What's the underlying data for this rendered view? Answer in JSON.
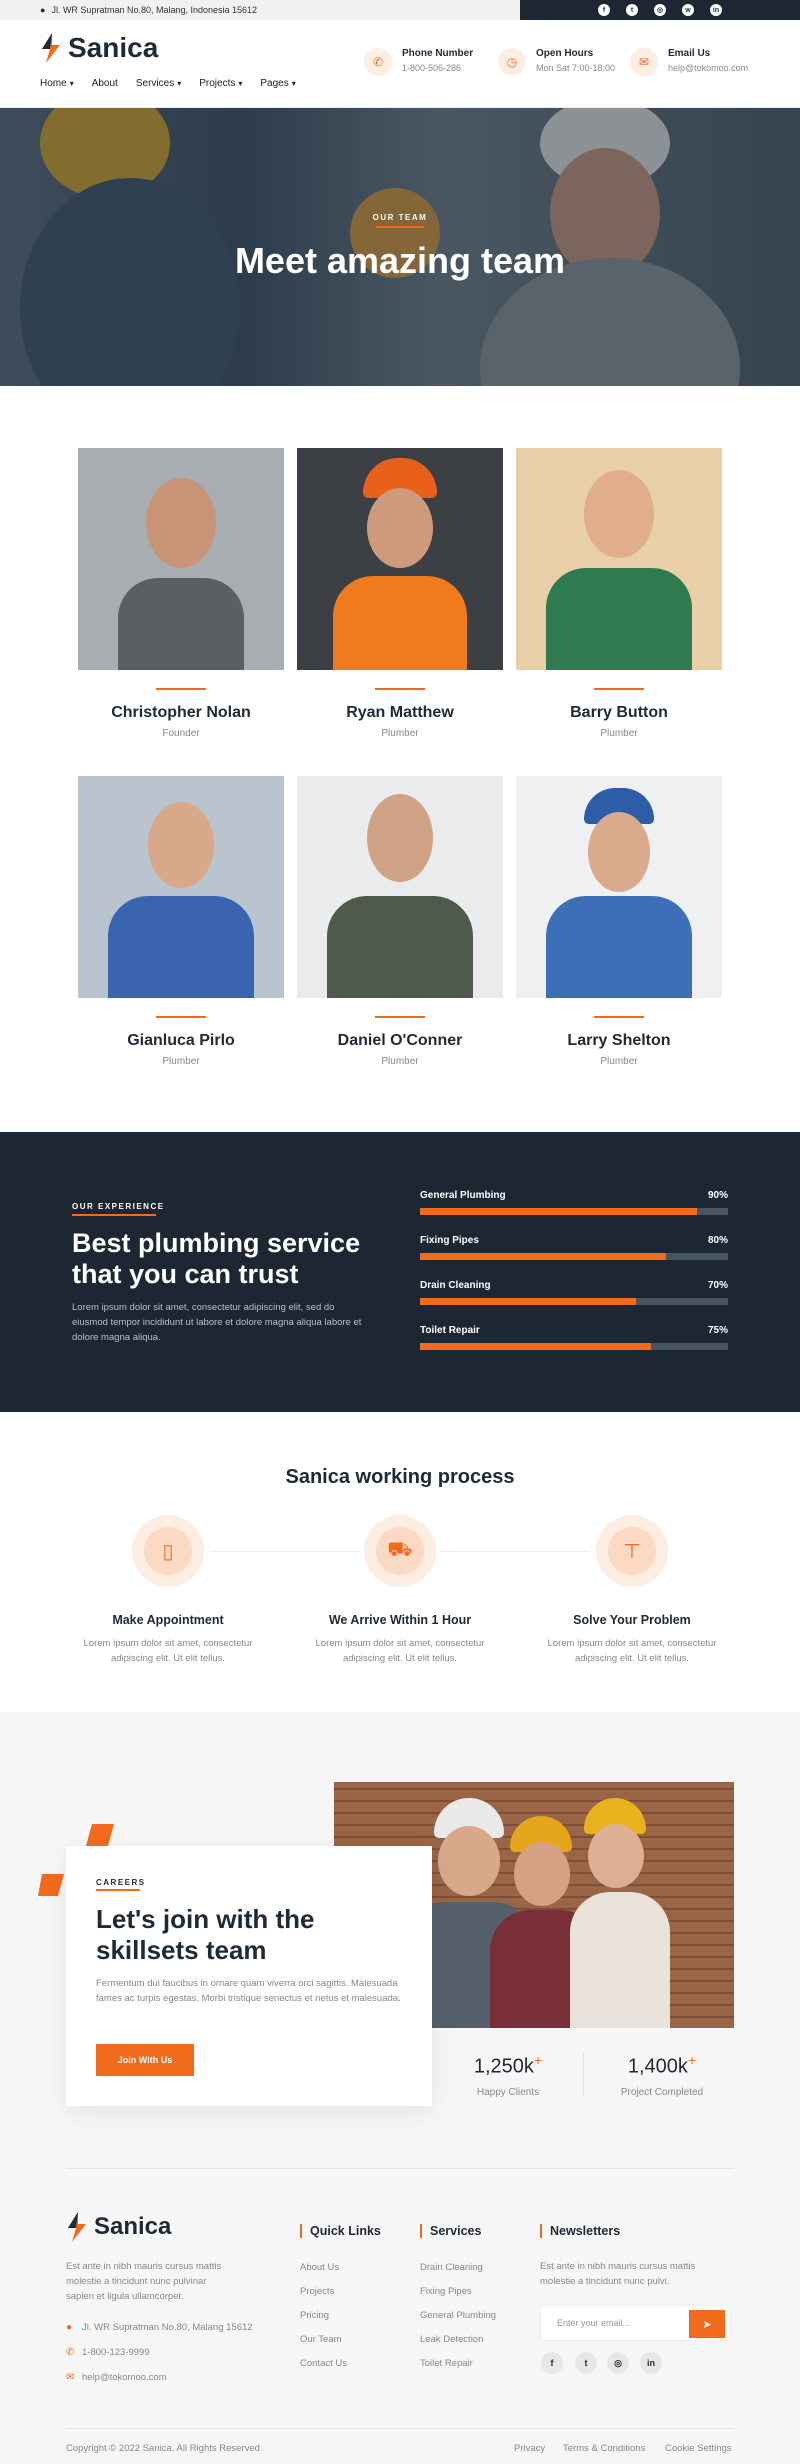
{
  "topbar": {
    "address": "Jl. WR Supratman No.80, Malang, Indonesia 15612",
    "social": [
      "facebook-icon",
      "twitter-icon",
      "instagram-icon",
      "whatsapp-icon",
      "linkedin-icon"
    ]
  },
  "header": {
    "brand": "Sanica",
    "nav": [
      {
        "label": "Home",
        "dropdown": true
      },
      {
        "label": "About",
        "dropdown": false
      },
      {
        "label": "Services",
        "dropdown": true
      },
      {
        "label": "Projects",
        "dropdown": true
      },
      {
        "label": "Pages",
        "dropdown": true
      }
    ],
    "info": [
      {
        "icon": "phone-icon",
        "title": "Phone Number",
        "value": "1-800-506-286"
      },
      {
        "icon": "clock-icon",
        "title": "Open Hours",
        "value": "Mon Sat 7:00-18:00"
      },
      {
        "icon": "mail-icon",
        "title": "Email Us",
        "value": "help@tokomoo.com"
      }
    ]
  },
  "hero": {
    "kicker": "OUR TEAM",
    "title": "Meet amazing team"
  },
  "team": [
    {
      "name": "Christopher Nolan",
      "role": "Founder"
    },
    {
      "name": "Ryan Matthew",
      "role": "Plumber"
    },
    {
      "name": "Barry Button",
      "role": "Plumber"
    },
    {
      "name": "Gianluca Pirlo",
      "role": "Plumber"
    },
    {
      "name": "Daniel O'Conner",
      "role": "Plumber"
    },
    {
      "name": "Larry Shelton",
      "role": "Plumber"
    }
  ],
  "experience": {
    "kicker": "OUR EXPERIENCE",
    "title": "Best plumbing service that you can trust",
    "text": "Lorem ipsum dolor sit amet, consectetur adipiscing elit, sed do eiusmod tempor incididunt ut labore et dolore magna aliqua labore et dolore magna aliqua.",
    "skills": [
      {
        "label": "General Plumbing",
        "percent": "90%",
        "value": 90
      },
      {
        "label": "Fixing Pipes",
        "percent": "80%",
        "value": 80
      },
      {
        "label": "Drain Cleaning",
        "percent": "70%",
        "value": 70
      },
      {
        "label": "Toilet Repair",
        "percent": "75%",
        "value": 75
      }
    ]
  },
  "process": {
    "title": "Sanica working process",
    "steps": [
      {
        "icon": "phone-icon",
        "title": "Make Appointment",
        "text": "Lorem ipsum dolor sit amet, consectetur adipiscing elit. Ut elit tellus."
      },
      {
        "icon": "truck-icon",
        "title": "We Arrive Within 1 Hour",
        "text": "Lorem ipsum dolor sit amet, consectetur adipiscing elit. Ut elit tellus."
      },
      {
        "icon": "faucet-icon",
        "title": "Solve Your Problem",
        "text": "Lorem ipsum dolor sit amet, consectetur adipiscing elit. Ut elit tellus."
      }
    ]
  },
  "careers": {
    "kicker": "CAREERS",
    "title": "Let's join with the skillsets team",
    "text": "Fermentum dui faucibus in ornare quam viverra orci sagittis. Malesuada fames ac turpis egestas. Morbi tristique senectus et netus et malesuada.",
    "button": "Join With Us",
    "stats": [
      {
        "value": "1,250k",
        "plus": "+",
        "label": "Happy Clients"
      },
      {
        "value": "1,400k",
        "plus": "+",
        "label": "Project Completed"
      }
    ]
  },
  "footer": {
    "brand": "Sanica",
    "desc": "Est ante in nibh mauris cursus mattis molestie a tincidunt nunc pulvinar sapien et ligula ullamcorper.",
    "address": "Jl. WR Supratman No.80, Malang 15612",
    "phone": "1-800-123-9999",
    "email": "help@tokomoo.com",
    "quick_title": "Quick Links",
    "quick_links": [
      "About Us",
      "Projects",
      "Pricing",
      "Our Team",
      "Contact Us"
    ],
    "services_title": "Services",
    "services": [
      "Drain Cleaning",
      "Fixing Pipes",
      "General Plumbing",
      "Leak Detection",
      "Toilet Repair"
    ],
    "news_title": "Newsletters",
    "news_text": "Est ante in nibh mauris cursus mattis molestie a tincidunt nunc pulvi.",
    "news_placeholder": "Enter your email...",
    "social": [
      "facebook-icon",
      "twitter-icon",
      "instagram-icon",
      "linkedin-icon"
    ],
    "copyright": "Copyright © 2022 Sanica. All Rights Reserved",
    "legal": [
      "Privacy",
      "Terms & Conditions",
      "Cookie Settings"
    ]
  },
  "colors": {
    "accent": "#f26b1d",
    "dark": "#1c2733"
  }
}
